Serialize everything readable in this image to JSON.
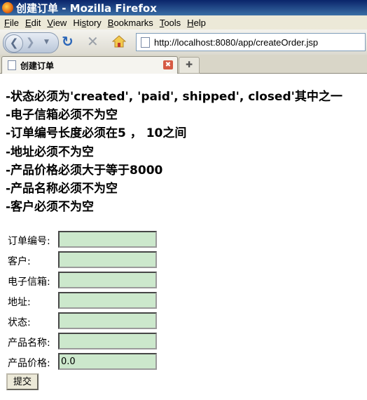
{
  "window": {
    "title": "创建订单 - Mozilla Firefox"
  },
  "menu": {
    "items": [
      {
        "label": "File",
        "accel": "F"
      },
      {
        "label": "Edit",
        "accel": "E"
      },
      {
        "label": "View",
        "accel": "V"
      },
      {
        "label": "History",
        "accel": "s"
      },
      {
        "label": "Bookmarks",
        "accel": "B"
      },
      {
        "label": "Tools",
        "accel": "T"
      },
      {
        "label": "Help",
        "accel": "H"
      }
    ]
  },
  "navbar": {
    "url": "http://localhost:8080/app/createOrder.jsp"
  },
  "tabs": [
    {
      "label": "创建订单"
    }
  ],
  "rules": [
    "-状态必须为'created', 'paid', shipped', closed'其中之一",
    "-电子信箱必须不为空",
    "-订单编号长度必须在5 ， 10之间",
    "-地址必须不为空",
    "-产品价格必须大于等于8000",
    "-产品名称必须不为空",
    "-客户必须不为空"
  ],
  "form": {
    "fields": [
      {
        "label": "订单编号:",
        "value": ""
      },
      {
        "label": "客户:",
        "value": ""
      },
      {
        "label": "电子信箱:",
        "value": ""
      },
      {
        "label": "地址:",
        "value": ""
      },
      {
        "label": "状态:",
        "value": ""
      },
      {
        "label": "产品名称:",
        "value": ""
      },
      {
        "label": "产品价格:",
        "value": "0.0"
      }
    ],
    "submit_label": "提交"
  },
  "colors": {
    "input_bg": "#cce8cc",
    "titlebar": "#0a246a"
  }
}
